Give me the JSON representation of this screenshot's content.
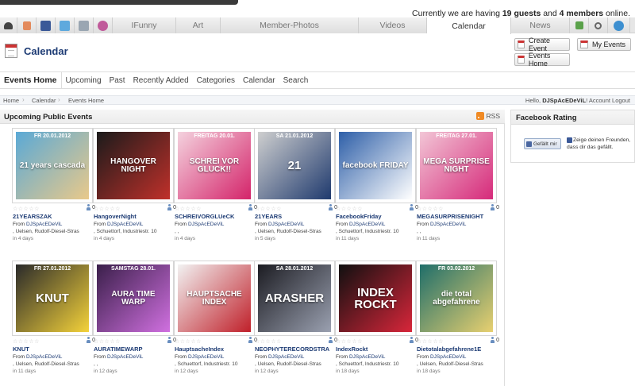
{
  "online": {
    "prefix": "Currently we are having",
    "guests": "19 guests",
    "and": "and",
    "members": "4 members",
    "suffix": "online."
  },
  "nav": {
    "tabs": [
      "IFunny",
      "Art",
      "Member-Photos",
      "Videos",
      "Calendar",
      "News"
    ],
    "active": "Calendar"
  },
  "header": {
    "title": "Calendar",
    "create_event": "Create Event",
    "my_events": "My Events",
    "events_home": "Events Home"
  },
  "subnav": [
    "Events Home",
    "Upcoming",
    "Past",
    "Recently Added",
    "Categories",
    "Calendar",
    "Search"
  ],
  "breadcrumb": [
    "Home",
    "Calendar",
    "Events Home"
  ],
  "user": {
    "hello": "Hello,",
    "name": "DJSpAcEDeViL",
    "sep": "!",
    "account": "Account",
    "logout": "Logout"
  },
  "events_panel": {
    "title": "Upcoming Public Events",
    "rss": "RSS"
  },
  "events": [
    {
      "name": "21YEARSZAK",
      "from_prefix": "From",
      "from": "DJSpAcEDeViL",
      "location": ", Uelsen, Rudolf-Diesel-Stras",
      "when": "in 4 days",
      "rsvp": "0",
      "poster_date": "FR 20.01.2012",
      "poster_text": "21 years cascada",
      "colors": [
        "#5aa9d6",
        "#e9c98a"
      ]
    },
    {
      "name": "HangoverNight",
      "from_prefix": "From",
      "from": "DJSpAcEDeViL",
      "location": ", Schuettorf, Industriestr. 10",
      "when": "in 4 days",
      "rsvp": "0",
      "poster_date": "",
      "poster_text": "HANGOVER NIGHT",
      "colors": [
        "#1b1b1b",
        "#c0302a"
      ]
    },
    {
      "name": "SCHREIVORGLUeCK",
      "from_prefix": "From",
      "from": "DJSpAcEDeViL",
      "location": ", ,",
      "when": "in 4 days",
      "rsvp": "0",
      "poster_date": "FREITAG 20.01.",
      "poster_text": "SCHREI VOR GLUCK!!",
      "colors": [
        "#f4d2de",
        "#d4246a"
      ]
    },
    {
      "name": "21YEARS",
      "from_prefix": "From",
      "from": "DJSpAcEDeViL",
      "location": ", Uelsen, Rudolf-Diesel-Stras",
      "when": "in 5 days",
      "rsvp": "0",
      "poster_date": "SA 21.01.2012",
      "poster_text": "21",
      "colors": [
        "#cfcfcf",
        "#1f3a6e"
      ]
    },
    {
      "name": "FacebookFriday",
      "from_prefix": "From",
      "from": "DJSpAcEDeViL",
      "location": ", Schuettorf, Industriestr. 10",
      "when": "in 11 days",
      "rsvp": "0",
      "poster_date": "",
      "poster_text": "facebook FRIDAY",
      "colors": [
        "#2e5fa8",
        "#ffffff"
      ]
    },
    {
      "name": "MEGASURPRISENIGHT",
      "from_prefix": "From",
      "from": "DJSpAcEDeViL",
      "location": ", ,",
      "when": "in 11 days",
      "rsvp": "0",
      "poster_date": "FREITAG 27.01.",
      "poster_text": "MEGA SURPRISE NIGHT",
      "colors": [
        "#f2c6d6",
        "#d62a7a"
      ]
    },
    {
      "name": "KNUT",
      "from_prefix": "From",
      "from": "DJSpAcEDeViL",
      "location": ", Uelsen, Rudolf-Diesel-Stras",
      "when": "in 11 days",
      "rsvp": "0",
      "poster_date": "FR 27.01.2012",
      "poster_text": "KNUT",
      "colors": [
        "#2a2a2a",
        "#f4d23a"
      ]
    },
    {
      "name": "AURATIMEWARP",
      "from_prefix": "From",
      "from": "DJSpAcEDeViL",
      "location": ", ,",
      "when": "in 12 days",
      "rsvp": "0",
      "poster_date": "SAMSTAG 28.01.",
      "poster_text": "AURA TIME WARP",
      "colors": [
        "#3a1f4a",
        "#d070e0"
      ]
    },
    {
      "name": "HauptsacheIndex",
      "from_prefix": "From",
      "from": "DJSpAcEDeViL",
      "location": ", Schuettorf, Industriestr. 10",
      "when": "in 12 days",
      "rsvp": "0",
      "poster_date": "",
      "poster_text": "HAUPTSACHE INDEX",
      "colors": [
        "#f2f2f2",
        "#c0202a"
      ]
    },
    {
      "name": "NEOPHYTERECORDSTRA",
      "from_prefix": "From",
      "from": "DJSpAcEDeViL",
      "location": ", Uelsen, Rudolf-Diesel-Stras",
      "when": "in 12 days",
      "rsvp": "0",
      "poster_date": "SA 28.01.2012",
      "poster_text": "ARASHER",
      "colors": [
        "#1c1c22",
        "#9aa0b0"
      ]
    },
    {
      "name": "IndexRockt",
      "from_prefix": "From",
      "from": "DJSpAcEDeViL",
      "location": ", Schuettorf, Industriestr. 10",
      "when": "in 18 days",
      "rsvp": "0",
      "poster_date": "",
      "poster_text": "INDEX ROCKT",
      "colors": [
        "#101010",
        "#d8263a"
      ]
    },
    {
      "name": "Dietotalabgefahrene1E",
      "from_prefix": "From",
      "from": "DJSpAcEDeViL",
      "location": ", Uelsen, Rudolf-Diesel-Stras",
      "when": "in 18 days",
      "rsvp": "0",
      "poster_date": "FR 03.02.2012",
      "poster_text": "die total abgefahrene",
      "colors": [
        "#1f6e6a",
        "#e8d070"
      ]
    }
  ],
  "facebook": {
    "title": "Facebook Rating",
    "like": "Gefällt mir",
    "text": "Zeige deinen Freunden, dass dir das gefällt."
  }
}
